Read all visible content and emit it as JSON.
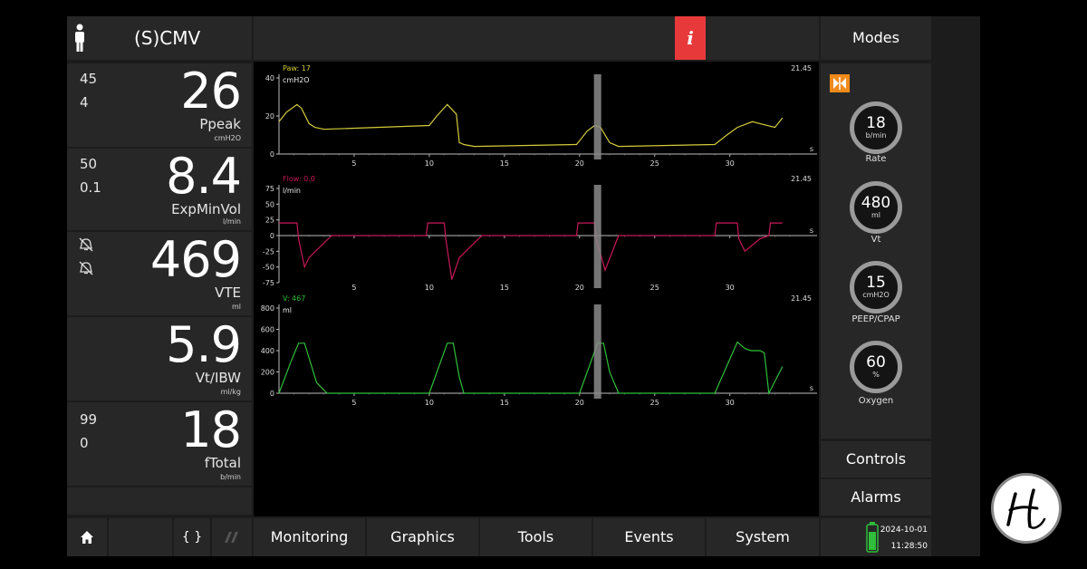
{
  "header": {
    "mode": "(S)CMV",
    "info_symbol": "i",
    "modes_label": "Modes"
  },
  "parameters": [
    {
      "id": "ppeak",
      "limits": [
        "45",
        "4"
      ],
      "value": "26",
      "name": "Ppeak",
      "unit": "cmH2O"
    },
    {
      "id": "expminvol",
      "limits": [
        "50",
        "0.1"
      ],
      "value": "8.4",
      "name": "ExpMinVol",
      "unit": "l/min"
    },
    {
      "id": "vte",
      "limits": [
        "",
        ""
      ],
      "value": "469",
      "name": "VTE",
      "unit": "ml"
    },
    {
      "id": "vt-ibw",
      "limits": [
        "",
        ""
      ],
      "value": "5.9",
      "name": "Vt/IBW",
      "unit": "ml/kg"
    },
    {
      "id": "ftotal",
      "limits": [
        "99",
        "0"
      ],
      "value": "18",
      "name": "fTotal",
      "unit": "b/min"
    }
  ],
  "controls": [
    {
      "id": "rate",
      "value": "18",
      "unit": "b/min",
      "label": "Rate"
    },
    {
      "id": "vt",
      "value": "480",
      "unit": "ml",
      "label": "Vt"
    },
    {
      "id": "peep",
      "value": "15",
      "unit": "cmH2O",
      "label": "PEEP/CPAP"
    },
    {
      "id": "oxygen",
      "value": "60",
      "unit": "%",
      "label": "Oxygen"
    }
  ],
  "right_buttons": {
    "controls": "Controls",
    "alarms": "Alarms"
  },
  "nav": {
    "tabs": [
      "Monitoring",
      "Graphics",
      "Tools",
      "Events",
      "System"
    ],
    "braces": "{ }"
  },
  "status": {
    "date": "2024-10-01",
    "time": "11:28:50"
  },
  "colors": {
    "pressure": "#d4cc3a",
    "flow": "#c8185a",
    "volume": "#2fbf3a",
    "info": "#e8393a",
    "sync": "#f08a1a"
  },
  "chart_data": [
    {
      "type": "line",
      "readout": "Paw: 17",
      "ylabel": "cmH2O",
      "time_label": "21.45",
      "xunit": "s",
      "xlim": [
        0,
        34.6
      ],
      "ylim": [
        0,
        40
      ],
      "yticks": [
        0,
        20,
        40
      ],
      "xticks": [
        5,
        10,
        15,
        20,
        25,
        30
      ],
      "color": "#d4cc3a",
      "x": [
        0,
        0.5,
        1.2,
        1.5,
        2.0,
        2.4,
        3.0,
        10.0,
        10.5,
        11.2,
        11.8,
        12.0,
        12.3,
        13.0,
        19.8,
        20.5,
        21.0,
        21.4,
        22.0,
        22.6,
        29.0,
        29.8,
        30.5,
        31.5,
        32.0,
        33.0,
        33.5
      ],
      "y": [
        17,
        22,
        26,
        24,
        16,
        14,
        13,
        15,
        20,
        26,
        21,
        6,
        5,
        4,
        5,
        12,
        15,
        14,
        6,
        4,
        5,
        10,
        14,
        17,
        16,
        14,
        19
      ]
    },
    {
      "type": "line",
      "readout": "Flow: 0.0",
      "ylabel": "l/min",
      "time_label": "21.45",
      "xunit": "s",
      "xlim": [
        0,
        34.6
      ],
      "ylim": [
        -75,
        75
      ],
      "yticks": [
        75,
        50,
        25,
        0,
        -25,
        -50,
        -75
      ],
      "xticks": [
        5,
        10,
        15,
        20,
        25,
        30
      ],
      "color": "#c8185a",
      "x": [
        0,
        1.2,
        1.3,
        1.7,
        2.0,
        3.5,
        9.8,
        9.9,
        11.0,
        11.1,
        11.5,
        12.0,
        13.5,
        19.8,
        19.9,
        21.0,
        21.1,
        21.7,
        22.6,
        29.0,
        29.1,
        30.5,
        30.6,
        31.0,
        32.0,
        32.6,
        32.7,
        33.5
      ],
      "y": [
        20,
        20,
        -5,
        -50,
        -35,
        0,
        0,
        20,
        20,
        -5,
        -70,
        -35,
        0,
        0,
        20,
        20,
        -5,
        -55,
        0,
        0,
        20,
        20,
        -5,
        -25,
        -5,
        0,
        20,
        20
      ]
    },
    {
      "type": "line",
      "readout": "V: 467",
      "ylabel": "ml",
      "time_label": "21.45",
      "xunit": "s",
      "xlim": [
        0,
        34.6
      ],
      "ylim": [
        0,
        800
      ],
      "yticks": [
        0,
        200,
        400,
        600,
        800
      ],
      "xticks": [
        5,
        10,
        15,
        20,
        25,
        30
      ],
      "color": "#2fbf3a",
      "x": [
        0,
        0.8,
        1.3,
        1.7,
        2.5,
        3.2,
        10.0,
        11.2,
        11.6,
        12.0,
        12.3,
        20.0,
        21.2,
        21.6,
        22.0,
        22.6,
        29.0,
        30.5,
        31.0,
        31.4,
        32.0,
        32.3,
        32.6,
        33.5
      ],
      "y": [
        0,
        300,
        470,
        470,
        100,
        0,
        0,
        470,
        470,
        150,
        0,
        0,
        470,
        470,
        200,
        0,
        0,
        480,
        420,
        400,
        400,
        380,
        0,
        250
      ]
    }
  ]
}
